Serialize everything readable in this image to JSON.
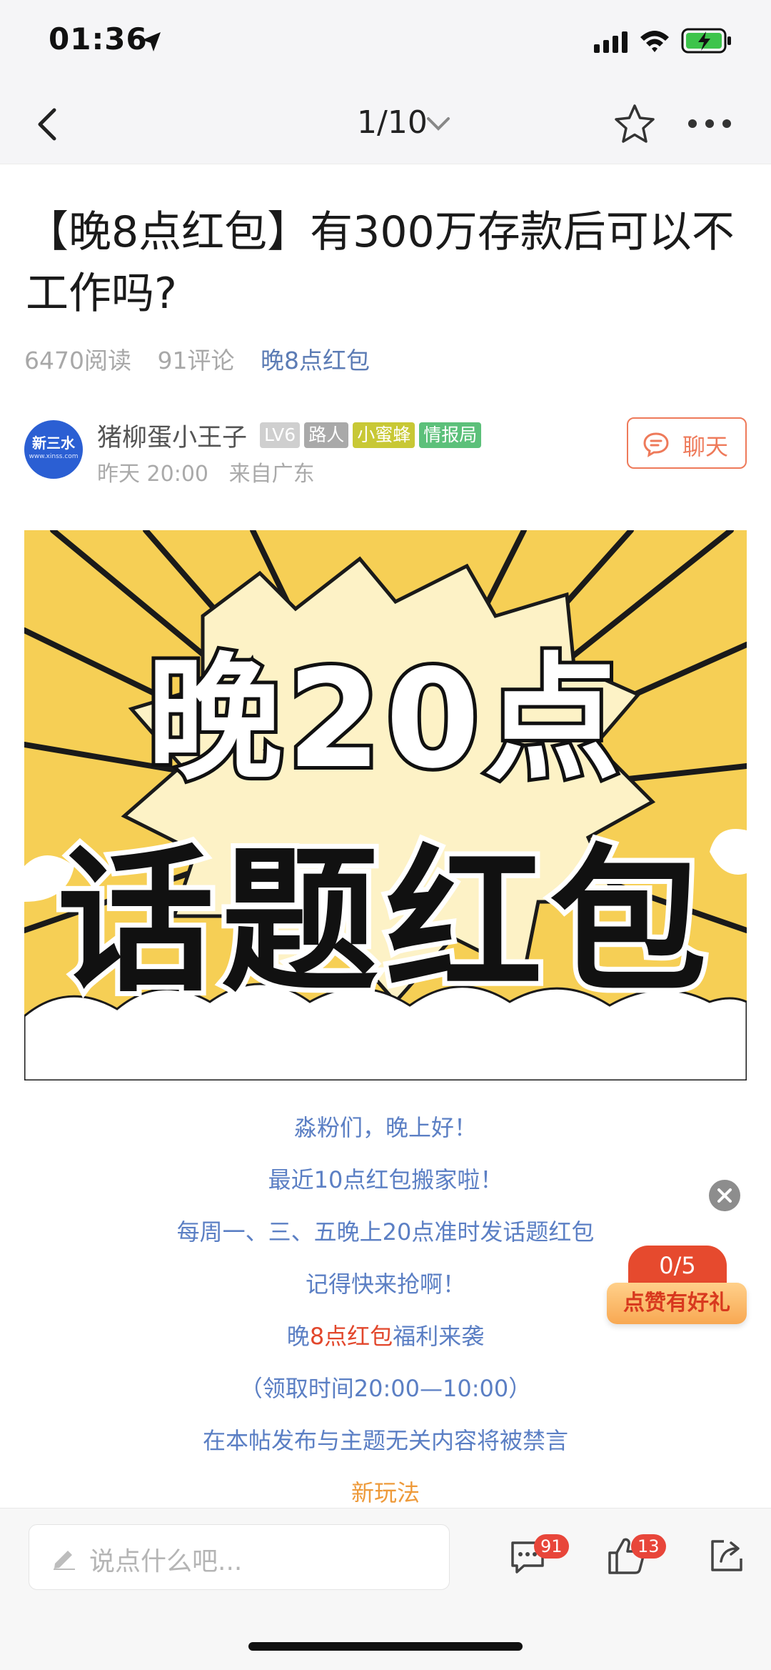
{
  "status": {
    "time": "01:36"
  },
  "nav": {
    "page_indicator": "1/10"
  },
  "post": {
    "title": "【晚8点红包】有300万存款后可以不工作吗?",
    "reads": "6470阅读",
    "comments": "91评论",
    "topic": "晚8点红包"
  },
  "author": {
    "avatar_text": "新三水",
    "avatar_sub": "www.xinss.com",
    "name": "猪柳蛋小王子",
    "badges": [
      "LV6",
      "路人",
      "小蜜蜂",
      "情报局"
    ],
    "time": "昨天 20:00",
    "location": "来自广东",
    "chat_label": "聊天"
  },
  "banner": {
    "line1": "晚20点",
    "line2": "话题红包"
  },
  "body": {
    "l1": "淼粉们，晚上好！",
    "l2": "最近10点红包搬家啦！",
    "l3": "每周一、三、五晚上20点准时发话题红包",
    "l4": "记得快来抢啊！",
    "l5_a": "晚",
    "l5_b": "8点红包",
    "l5_c": "福利来袭",
    "l6": "（领取时间20:00—10:00）",
    "l7": "在本帖发布与主题无关内容将被禁言",
    "l8": "新玩法"
  },
  "reward": {
    "progress": "0/5",
    "label": "点赞有好礼"
  },
  "bottom": {
    "placeholder": "说点什么吧...",
    "comment_count": "91",
    "like_count": "13"
  },
  "colors": {
    "accent": "#ee7a5a",
    "link": "#5b7fc4",
    "badge_red": "#e8463a"
  }
}
